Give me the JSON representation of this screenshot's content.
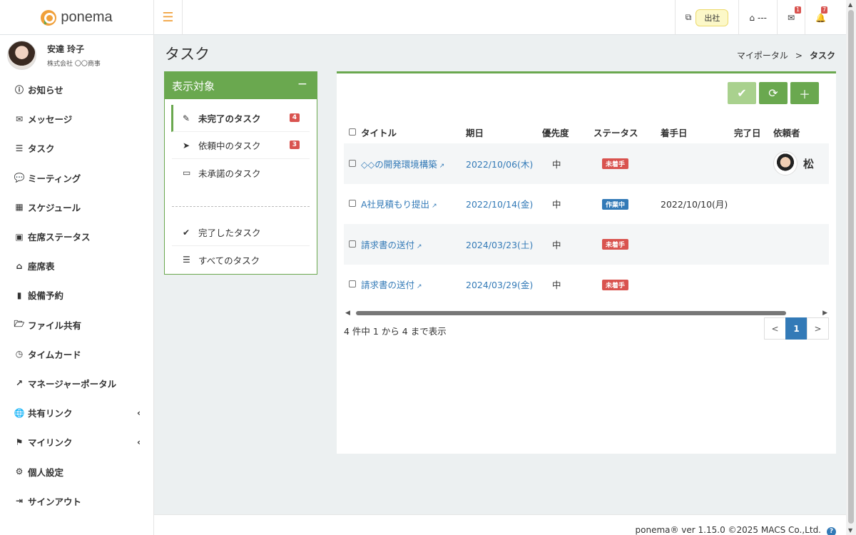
{
  "header": {
    "logo_text": "ponema",
    "menu_icon": "hamburger-icon",
    "attend_label": "出社",
    "seat_text": "---",
    "message_count": "1",
    "notification_count": "7"
  },
  "user": {
    "name": "安達 玲子",
    "company": "株式会社 〇〇商事"
  },
  "sidebar": {
    "items": [
      {
        "label": "お知らせ",
        "icon": "ⓘ"
      },
      {
        "label": "メッセージ",
        "icon": "✉"
      },
      {
        "label": "タスク",
        "icon": "☰"
      },
      {
        "label": "ミーティング",
        "icon": "💬"
      },
      {
        "label": "スケジュール",
        "icon": "▦"
      },
      {
        "label": "在席ステータス",
        "icon": "▣"
      },
      {
        "label": "座席表",
        "icon": "⌂"
      },
      {
        "label": "設備予約",
        "icon": "▮"
      },
      {
        "label": "ファイル共有",
        "icon": "🗁"
      },
      {
        "label": "タイムカード",
        "icon": "◷"
      },
      {
        "label": "マネージャーポータル",
        "icon": "↗"
      },
      {
        "label": "共有リンク",
        "icon": "🌐"
      },
      {
        "label": "マイリンク",
        "icon": "⚑"
      },
      {
        "label": "個人設定",
        "icon": "⚙"
      },
      {
        "label": "サインアウト",
        "icon": "⇥"
      }
    ]
  },
  "page": {
    "title": "タスク",
    "breadcrumb_home": "マイポータル",
    "breadcrumb_sep": ">",
    "breadcrumb_current": "タスク"
  },
  "filter": {
    "title": "表示対象",
    "collapse": "−",
    "items": [
      {
        "label": "未完了のタスク",
        "badge": "4"
      },
      {
        "label": "依頼中のタスク",
        "badge": "3"
      },
      {
        "label": "未承諾のタスク"
      },
      {
        "label": "完了したタスク"
      },
      {
        "label": "すべてのタスク"
      }
    ]
  },
  "table": {
    "headers": {
      "title": "タイトル",
      "due": "期日",
      "priority": "優先度",
      "status": "ステータス",
      "start": "着手日",
      "done": "完了日",
      "requester": "依頼者"
    },
    "rows": [
      {
        "title": "◇◇の開発環境構築",
        "due": "2022/10/06(木)",
        "priority": "中",
        "status": "未着手",
        "status_color": "#d9534f",
        "start": "",
        "done": "",
        "requester": "松"
      },
      {
        "title": "A社見積もり提出",
        "due": "2022/10/14(金)",
        "priority": "中",
        "status": "作業中",
        "status_color": "#337ab7",
        "start": "2022/10/10(月)",
        "done": "",
        "requester": ""
      },
      {
        "title": "請求書の送付",
        "due": "2024/03/23(土)",
        "priority": "中",
        "status": "未着手",
        "status_color": "#d9534f",
        "start": "",
        "done": "",
        "requester": ""
      },
      {
        "title": "請求書の送付",
        "due": "2024/03/29(金)",
        "priority": "中",
        "status": "未着手",
        "status_color": "#d9534f",
        "start": "",
        "done": "",
        "requester": ""
      }
    ],
    "info": "4 件中 1 から 4 まで表示",
    "pager": {
      "prev": "<",
      "current": "1",
      "next": ">"
    }
  },
  "footer": {
    "text": "ponema® ver 1.15.0 ©2025 MACS Co.,Ltd.",
    "help": "?"
  }
}
